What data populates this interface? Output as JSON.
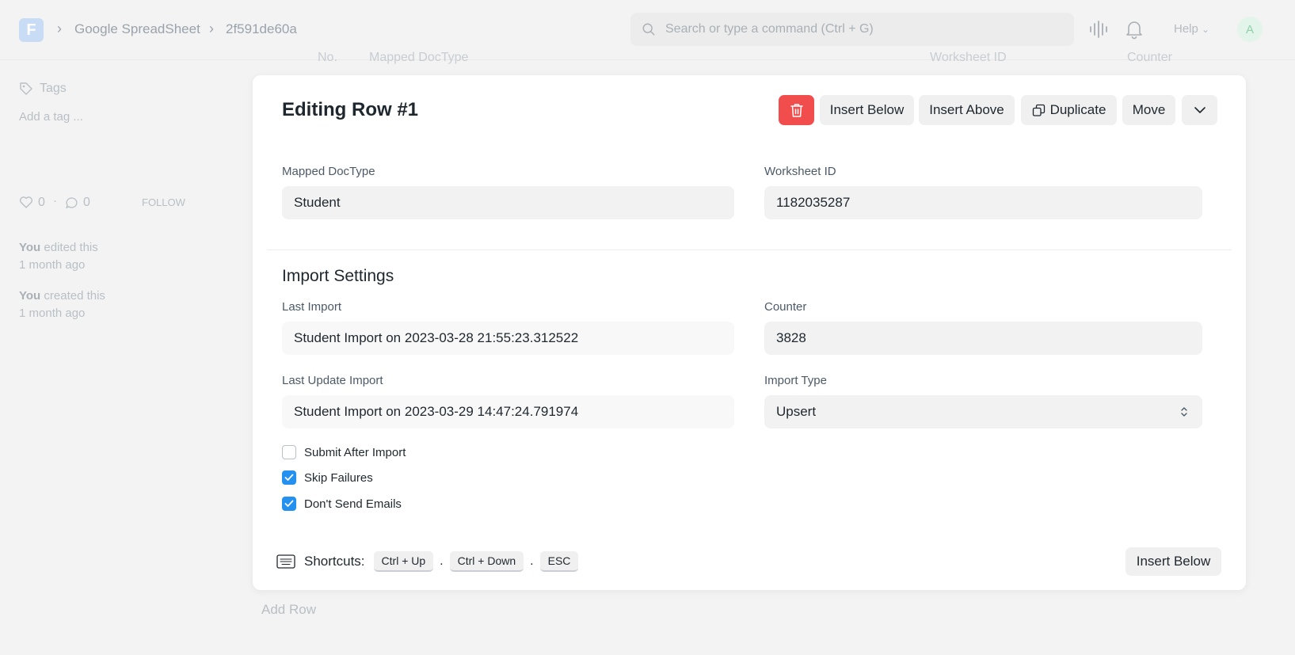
{
  "navbar": {
    "logo_letter": "F",
    "breadcrumbs": [
      "Google SpreadSheet",
      "2f591de60a"
    ],
    "search_placeholder": "Search or type a command (Ctrl + G)",
    "help_label": "Help",
    "avatar_initial": "A"
  },
  "sidebar": {
    "tags_label": "Tags",
    "add_tag": "Add a tag ...",
    "likes": "0",
    "comments": "0",
    "follow": "FOLLOW",
    "activity": [
      {
        "who": "You",
        "what": " edited this",
        "when": "1 month ago"
      },
      {
        "who": "You",
        "what": " created this",
        "when": "1 month ago"
      }
    ]
  },
  "grid_bg": {
    "headers": [
      "No.",
      "Mapped DocType",
      "Worksheet ID",
      "Counter"
    ],
    "add_row": "Add Row"
  },
  "dialog": {
    "title": "Editing Row #1",
    "buttons": {
      "insert_below": "Insert Below",
      "insert_above": "Insert Above",
      "duplicate": "Duplicate",
      "move": "Move"
    },
    "fields": {
      "mapped_doctype": {
        "label": "Mapped DocType",
        "value": "Student"
      },
      "worksheet_id": {
        "label": "Worksheet ID",
        "value": "1182035287"
      }
    },
    "section_title": "Import Settings",
    "settings": {
      "last_import": {
        "label": "Last Import",
        "value": "Student Import on 2023-03-28 21:55:23.312522"
      },
      "counter": {
        "label": "Counter",
        "value": "3828"
      },
      "last_update_import": {
        "label": "Last Update Import",
        "value": "Student Import on 2023-03-29 14:47:24.791974"
      },
      "import_type": {
        "label": "Import Type",
        "value": "Upsert"
      }
    },
    "checkboxes": [
      {
        "label": "Submit After Import",
        "checked": false
      },
      {
        "label": "Skip Failures",
        "checked": true
      },
      {
        "label": "Don't Send Emails",
        "checked": true
      }
    ],
    "shortcuts_label": "Shortcuts:",
    "shortcuts": [
      "Ctrl + Up",
      "Ctrl + Down",
      "ESC"
    ],
    "footer_button": "Insert Below"
  },
  "colors": {
    "danger": "#f24d4d",
    "checkbox_checked": "#2490ef",
    "logo": "#c9dcf5"
  }
}
